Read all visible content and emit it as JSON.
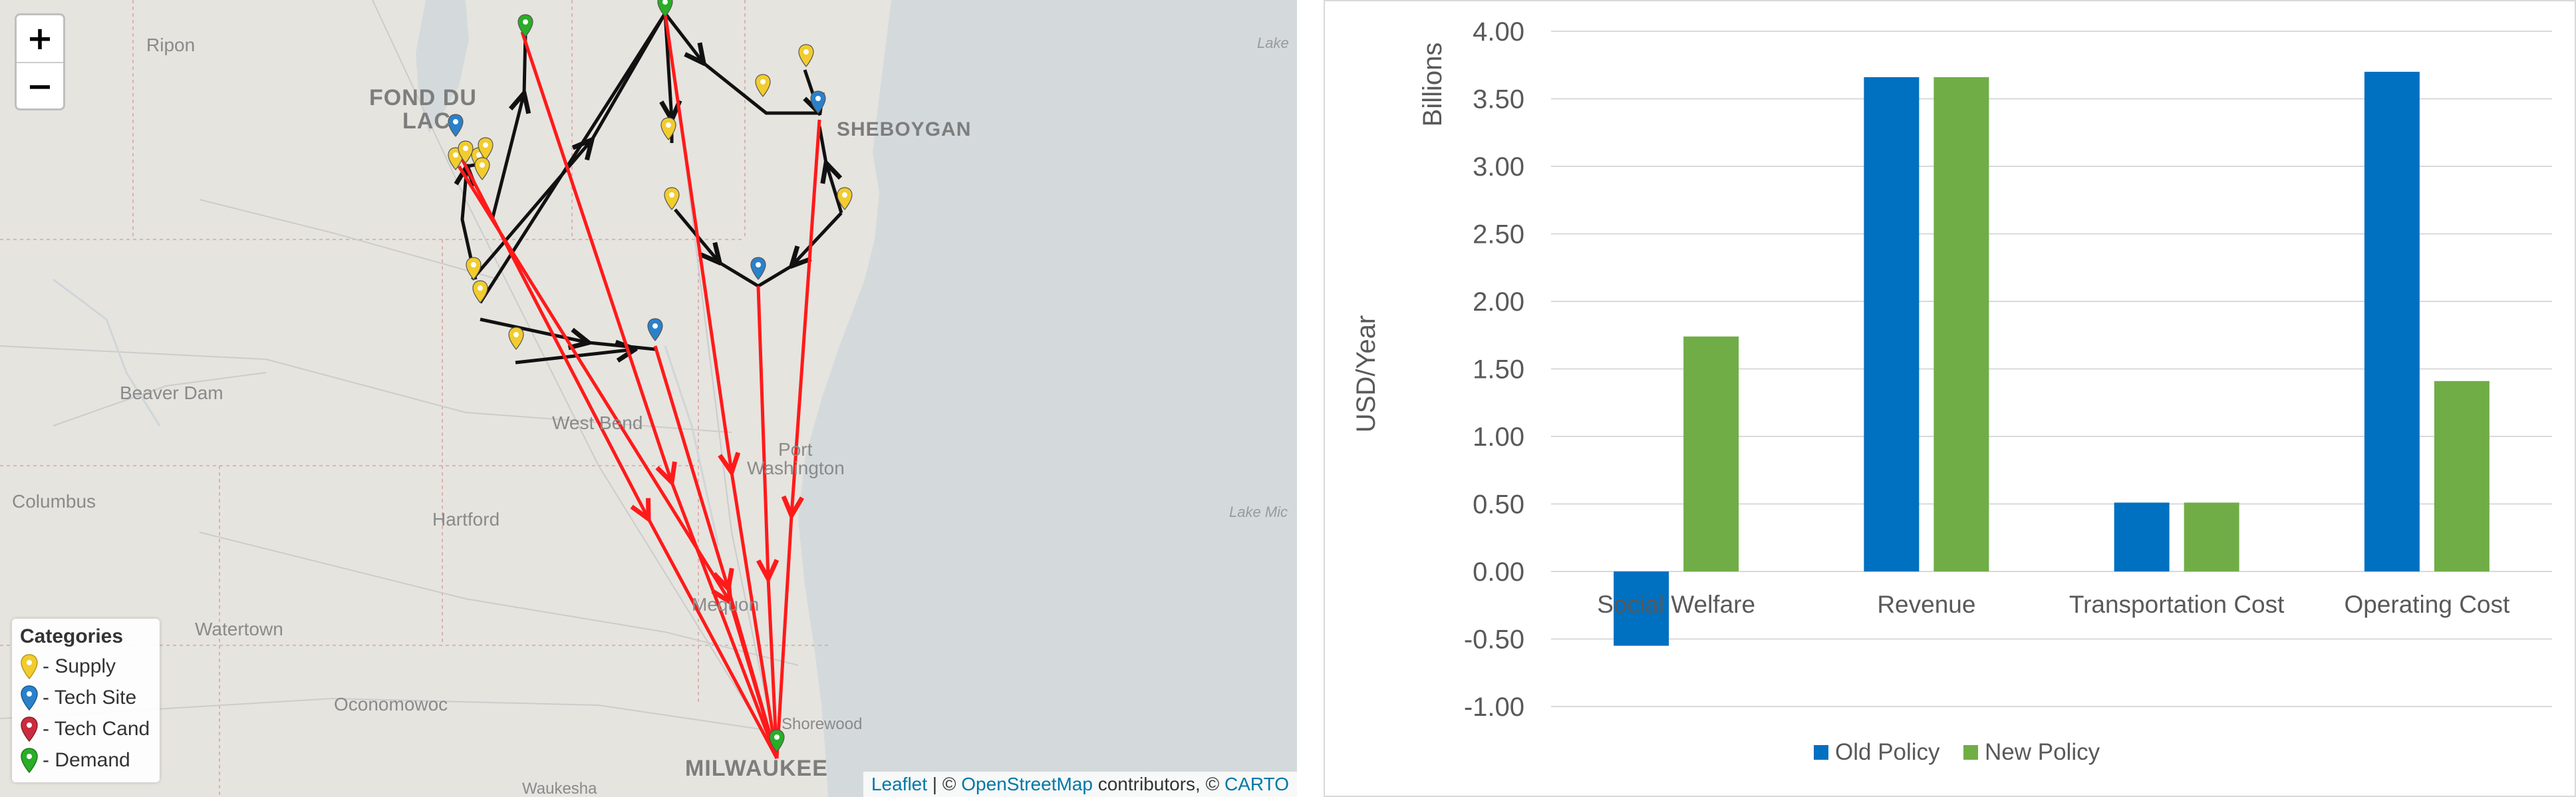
{
  "map": {
    "zoom_in": "+",
    "zoom_out": "−",
    "places": {
      "ripon": "Ripon",
      "fond_du": "FOND DU",
      "lac": "LAC",
      "sheboygan": "SHEBOYGAN",
      "beaver_dam": "Beaver Dam",
      "west_bend": "West Bend",
      "port": "Port",
      "washington": "Washington",
      "hartford": "Hartford",
      "columbus": "Columbus",
      "watertown": "Watertown",
      "oconomowoc": "Oconomowoc",
      "mequon": "Mequon",
      "milwaukee": "MILWAUKEE",
      "waukesha": "Waukesha",
      "shorewood": "Shorewood",
      "lake_top": "Lake",
      "lake_mid": "Lake Mic"
    },
    "legend": {
      "title": "Categories",
      "items": [
        {
          "label": "- Supply",
          "color": "#f2cc2e",
          "icon": "yellow-marker-icon"
        },
        {
          "label": "- Tech Site",
          "color": "#2a81cb",
          "icon": "blue-marker-icon"
        },
        {
          "label": "- Tech Cand",
          "color": "#cb2b3e",
          "icon": "red-marker-icon"
        },
        {
          "label": "- Demand",
          "color": "#2aad27",
          "icon": "green-marker-icon"
        }
      ]
    },
    "attribution": {
      "leaflet": "Leaflet",
      "sep1": " | © ",
      "osm": "OpenStreetMap",
      "contrib": " contributors, © ",
      "carto": "CARTO"
    },
    "colors": {
      "flow_black": "#111111",
      "flow_red": "#ff1a1a",
      "water": "#d4dadc",
      "land": "#e6e4df"
    }
  },
  "chart_data": {
    "type": "bar",
    "categories": [
      "Social Welfare",
      "Revenue",
      "Transportation Cost",
      "Operating Cost"
    ],
    "series": [
      {
        "name": "Old Policy",
        "color": "#0070c0",
        "values": [
          -0.55,
          3.66,
          0.51,
          3.7
        ]
      },
      {
        "name": "New Policy",
        "color": "#70ad47",
        "values": [
          1.74,
          3.66,
          0.51,
          1.41
        ]
      }
    ],
    "ylim": [
      -1.0,
      4.0
    ],
    "yticks": [
      "4.00",
      "3.50",
      "3.00",
      "2.50",
      "2.00",
      "1.50",
      "1.00",
      "0.50",
      "0.00",
      "-0.50",
      "-1.00"
    ],
    "ylabel": "USD/Year",
    "yunit": "Billions",
    "grid": true,
    "legend_position": "bottom"
  }
}
